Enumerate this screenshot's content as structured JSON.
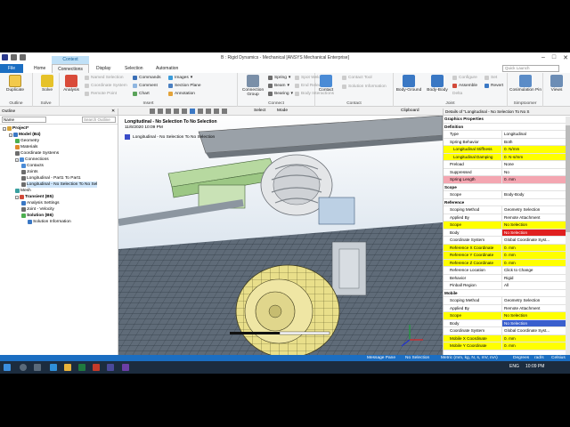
{
  "window": {
    "title": "B : Rigid Dynamics - Mechanical [ANSYS Mechanical Enterprise]",
    "context_tab": "Context"
  },
  "tabs": [
    "File",
    "Home",
    "Connections",
    "Display",
    "Selection",
    "Automation"
  ],
  "active_tab": "Connections",
  "quick_launch": "Quick Launch",
  "ribbon": {
    "duplicate": "Duplicate",
    "outline_group": "Outline",
    "solve": "Solve",
    "solve_group": "Solve",
    "analysis": "Analysis",
    "named_selection": "Named Selection",
    "coordinate_system": "Coordinate System",
    "remote_point": "Remote Point",
    "commands": "Commands",
    "comment": "Comment",
    "chart": "Chart",
    "images": "Images",
    "section_plane": "Section Plane",
    "annotation": "Annotation",
    "insert_group": "Insert",
    "connection_group": "Connection Group",
    "spring": "Spring",
    "beam": "Beam",
    "bearing": "Bearing",
    "spot_weld": "Spot Weld",
    "end_release": "End Release",
    "body_interactions": "Body Interactions",
    "connect_group": "Connect",
    "contact": "Contact",
    "contact_tool": "Contact Tool",
    "solution_information": "Solution Information",
    "contact_group": "Contact",
    "body_ground": "Body-Ground",
    "body_body": "Body-Body",
    "configure": "Configure",
    "set": "Set",
    "assemble": "Assemble",
    "revert": "Revert",
    "delta": "Delta",
    "joint_group": "Joint",
    "cosimulation_pin": "Cosimulation Pin",
    "views": "Views",
    "systemcoupling_group": "Simptoomer"
  },
  "toolbar": {
    "select": "Select",
    "mode": "Mode",
    "clipboard": "Clipboard"
  },
  "outline": {
    "title": "Outline",
    "filter": "Name",
    "search": "Search Outline",
    "nodes": [
      {
        "label": "Project*",
        "level": 0
      },
      {
        "label": "Model (B4)",
        "level": 1
      },
      {
        "label": "Geometry",
        "level": 2
      },
      {
        "label": "Materials",
        "level": 2
      },
      {
        "label": "Coordinate Systems",
        "level": 2
      },
      {
        "label": "Connections",
        "level": 2
      },
      {
        "label": "Contacts",
        "level": 3
      },
      {
        "label": "Joints",
        "level": 3
      },
      {
        "label": "Longitudinal - Part1 To Part1",
        "level": 3
      },
      {
        "label": "Longitudinal - No Selection To No Sel",
        "level": 3
      },
      {
        "label": "Mesh",
        "level": 2
      },
      {
        "label": "Transient (B5)",
        "level": 2
      },
      {
        "label": "Analysis Settings",
        "level": 3
      },
      {
        "label": "Joint - Velocity",
        "level": 3
      },
      {
        "label": "Solution (B6)",
        "level": 3
      },
      {
        "label": "Solution Information",
        "level": 4
      }
    ]
  },
  "viewport": {
    "label": "Longitudinal - No Selection To No Selection",
    "time": "11/6/2020 10:09 PM",
    "legend": "Longitudinal - No Selection To No Selection"
  },
  "details": {
    "title": "Details of \"Longitudinal - No Selection To No S",
    "rows": [
      {
        "k": "Graphics Properties",
        "t": "sec"
      },
      {
        "k": "Definition",
        "t": "sec"
      },
      {
        "k": "Type",
        "v": "Longitudinal"
      },
      {
        "k": "Spring Behavior",
        "v": "Both"
      },
      {
        "k": "Longitudinal Stiffness",
        "v": "0. N/mm",
        "t": "yel sub"
      },
      {
        "k": "Longitudinal Damping",
        "v": "0. N·s/mm",
        "t": "yel sub"
      },
      {
        "k": "Preload",
        "v": "None"
      },
      {
        "k": "Suppressed",
        "v": "No"
      },
      {
        "k": "Spring Length",
        "v": "0. mm",
        "t": "pink"
      },
      {
        "k": "Scope",
        "t": "sec"
      },
      {
        "k": "Scope",
        "v": "Body-Body"
      },
      {
        "k": "Reference",
        "t": "sec"
      },
      {
        "k": "Scoping Method",
        "v": "Geometry Selection"
      },
      {
        "k": "Applied By",
        "v": "Remote Attachment"
      },
      {
        "k": "Scope",
        "v": "No Selection",
        "t": "yel"
      },
      {
        "k": "Body",
        "v": "No Selection",
        "t": "red"
      },
      {
        "k": "Coordinate System",
        "v": "Global Coordinate Syst..."
      },
      {
        "k": "Reference X Coordinate",
        "v": "0. mm",
        "t": "yel"
      },
      {
        "k": "Reference Y Coordinate",
        "v": "0. mm",
        "t": "yel"
      },
      {
        "k": "Reference Z Coordinate",
        "v": "0. mm",
        "t": "yel"
      },
      {
        "k": "Reference Location",
        "v": "Click to Change"
      },
      {
        "k": "Behavior",
        "v": "Rigid"
      },
      {
        "k": "Pinball Region",
        "v": "All"
      },
      {
        "k": "Mobile",
        "t": "sec"
      },
      {
        "k": "Scoping Method",
        "v": "Geometry Selection"
      },
      {
        "k": "Applied By",
        "v": "Remote Attachment"
      },
      {
        "k": "Scope",
        "v": "No Selection",
        "t": "yel"
      },
      {
        "k": "Body",
        "v": "No Selection",
        "t": "blue"
      },
      {
        "k": "Coordinate System",
        "v": "Global Coordinate Syst..."
      },
      {
        "k": "Mobile X Coordinate",
        "v": "0. mm",
        "t": "yel"
      },
      {
        "k": "Mobile Y Coordinate",
        "v": "0. mm",
        "t": "yel"
      }
    ]
  },
  "statusbar": {
    "messages": "Message Pane",
    "selection": "No Selection",
    "units": "Metric (mm, kg, N, s, mV, mA)",
    "angle": "Degrees",
    "rate": "rad/s",
    "temp": "Celsius"
  },
  "taskbar": {
    "lang": "ENG",
    "time": "10:09 PM"
  }
}
